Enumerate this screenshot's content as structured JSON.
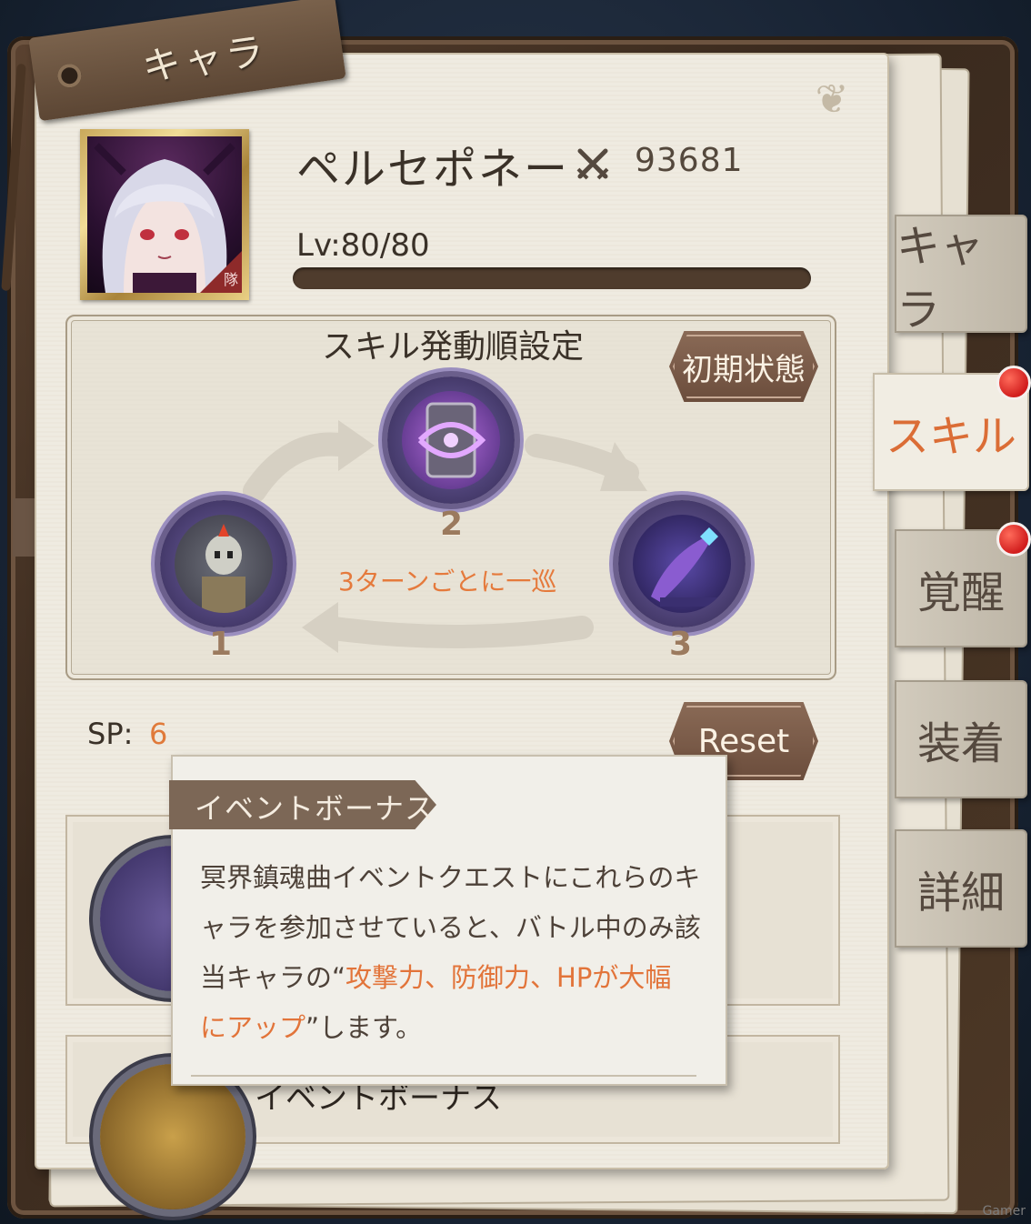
{
  "header": {
    "ribbon_label": "キャラ"
  },
  "character": {
    "name": "ペルセポネー",
    "power": "93681",
    "level_text": "Lv:80/80",
    "level_progress": 1.0,
    "portrait_badge": "隊"
  },
  "skill_order": {
    "title": "スキル発動順設定",
    "reset_initial_label": "初期状態",
    "cycle_text": "3ターンごとに一巡",
    "skills": [
      {
        "number": "1",
        "icon": "skeleton-knight-skill-icon"
      },
      {
        "number": "2",
        "icon": "dark-swirl-shield-skill-icon"
      },
      {
        "number": "3",
        "icon": "dark-scythe-skill-icon"
      }
    ]
  },
  "sp": {
    "label": "SP:",
    "value": "6",
    "reset_label": "Reset"
  },
  "tooltip": {
    "tag": "イベントボーナス",
    "line1": "冥界鎮魂曲イベントクエストにこれらのキ",
    "line2": "ャラを参加させていると、バトル中のみ該",
    "line3_pre": "当キャラの“",
    "line3_hl": "攻撃力、防御力、HPが大幅",
    "line4_hl": "にアップ",
    "line4_post": "”します。"
  },
  "skill_rows": {
    "row2_title": "イベントボーナス"
  },
  "tabs": [
    {
      "label": "キャラ",
      "active": false
    },
    {
      "label": "スキル",
      "active": true
    },
    {
      "label": "覚醒",
      "active": false
    },
    {
      "label": "装着",
      "active": false
    },
    {
      "label": "詳細",
      "active": false
    }
  ],
  "colors": {
    "accent": "#db6d36",
    "highlight": "#e2743a",
    "notify": "#d11d1d"
  },
  "watermark": "Gamer"
}
